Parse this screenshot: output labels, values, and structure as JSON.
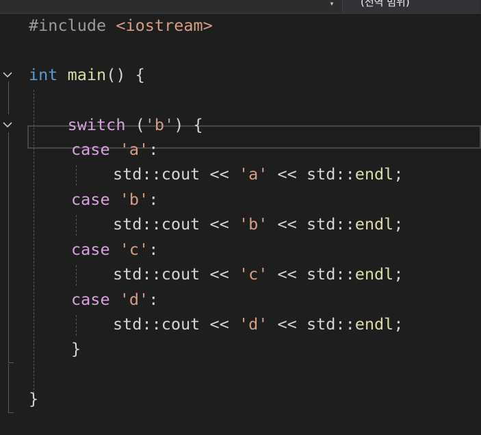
{
  "toolbar": {
    "dropdown_arrow": "▾",
    "scope_label": "(전역 범위)"
  },
  "code": {
    "line1": {
      "directive": "#include",
      "space": " ",
      "header": "<iostream>"
    },
    "line3": {
      "type": "int",
      "space": " ",
      "name": "main",
      "rest": "() {"
    },
    "line5": {
      "indent": "    ",
      "keyword": "switch",
      "open": " (",
      "value": "'b'",
      "close": ") {"
    },
    "cases": [
      {
        "keyword": "case",
        "value": "'a'",
        "colon": ":",
        "stmt_a": "std::cout << ",
        "literal": "'a'",
        "stmt_b": " << std::",
        "endl": "endl",
        "semi": ";"
      },
      {
        "keyword": "case",
        "value": "'b'",
        "colon": ":",
        "stmt_a": "std::cout << ",
        "literal": "'b'",
        "stmt_b": " << std::",
        "endl": "endl",
        "semi": ";"
      },
      {
        "keyword": "case",
        "value": "'c'",
        "colon": ":",
        "stmt_a": "std::cout << ",
        "literal": "'c'",
        "stmt_b": " << std::",
        "endl": "endl",
        "semi": ";"
      },
      {
        "keyword": "case",
        "value": "'d'",
        "colon": ":",
        "stmt_a": "std::cout << ",
        "literal": "'d'",
        "stmt_b": " << std::",
        "endl": "endl",
        "semi": ";"
      }
    ],
    "switch_close": "}",
    "main_close": "}"
  },
  "icons": {
    "fold_main": "chevron-down-icon",
    "fold_switch": "chevron-down-icon"
  },
  "colors": {
    "background": "#1e1e1e",
    "keyword": "#569cd6",
    "control": "#d8a0df",
    "function": "#dcdcaa",
    "string": "#d69d85",
    "text": "#d4d4d4"
  }
}
